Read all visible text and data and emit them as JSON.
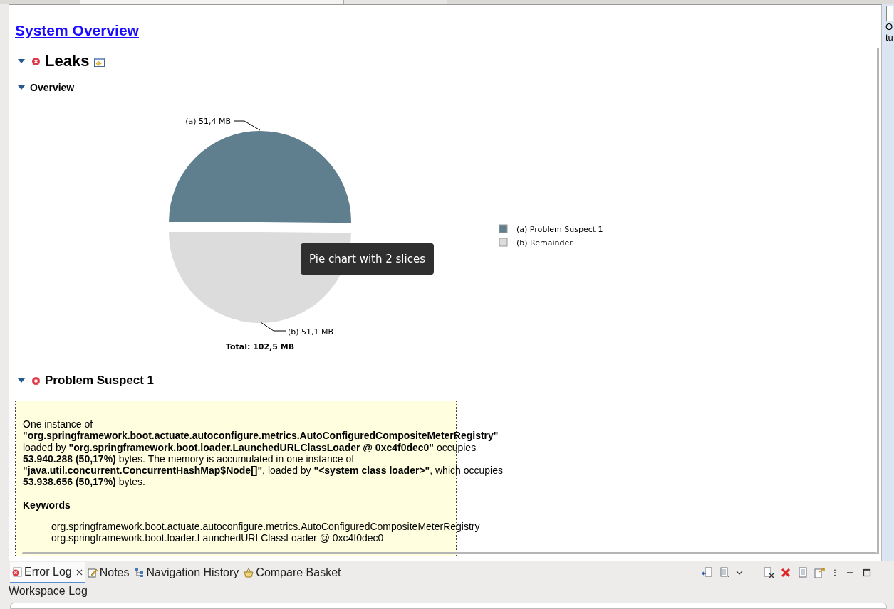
{
  "report": {
    "link": "System Overview",
    "leaks": {
      "title": "Leaks",
      "expanded": true
    },
    "overview": {
      "title": "Overview",
      "expanded": true,
      "chart": {
        "chart_data": {
          "type": "pie",
          "categories": [
            "(a)  Problem Suspect 1",
            "(b)  Remainder"
          ],
          "series": [
            {
              "values": [
                50.15,
                49.85
              ]
            }
          ],
          "colors": [
            "#607f8e",
            "#dcdcdc"
          ],
          "legend": "right"
        },
        "slice_labels": [
          "(a)  51,4 MB",
          "(b)  51,1 MB"
        ],
        "total": "Total: 102,5 MB",
        "tooltip": "Pie chart with 2 slices"
      }
    },
    "suspect": {
      "title": "Problem Suspect 1",
      "expanded": true,
      "description": "One instance of **\"org.springframework.boot.actuate.autoconfigure.metrics.AutoConfiguredCompositeMeterRegistry\"** loaded by **\"org.springframework.boot.loader.LaunchedURLClassLoader @ 0xc4f0dec0\"** occupies **53.940.288 (50,17%)** bytes. The memory is accumulated in one instance of **\"java.util.concurrent.ConcurrentHashMap$Node[]\"**, loaded by **\"<system class loader>\"**, which occupies **53.938.656 (50,17%)** bytes.",
      "keywords_title": "Keywords",
      "keywords": [
        "org.springframework.boot.actuate.autoconfigure.metrics.AutoConfiguredCompositeMeterRegistry",
        "org.springframework.boot.loader.LaunchedURLClassLoader @ 0xc4f0dec0"
      ]
    }
  },
  "side_text": [
    "O",
    "tu"
  ],
  "bottom_panel": {
    "tabs": [
      {
        "label": "Error Log",
        "kind": "error",
        "selected": true,
        "closable": true
      },
      {
        "label": "Notes",
        "kind": "notes",
        "selected": false,
        "closable": false
      },
      {
        "label": "Navigation History",
        "kind": "history",
        "selected": false,
        "closable": false
      },
      {
        "label": "Compare Basket",
        "kind": "basket",
        "selected": false,
        "closable": false
      }
    ],
    "view_title": "Workspace Log"
  }
}
